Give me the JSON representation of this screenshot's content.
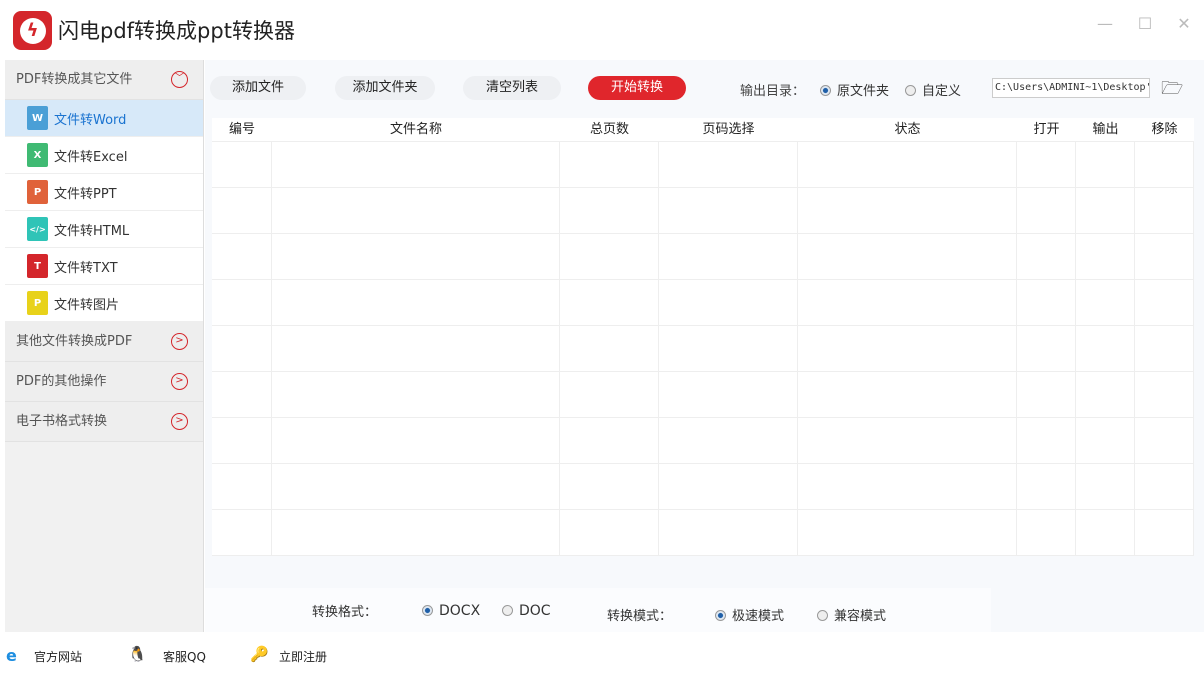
{
  "app": {
    "title": "闪电pdf转换成ppt转换器"
  },
  "sidebar": {
    "groups": [
      {
        "label": "PDF转换成其它文件"
      },
      {
        "label": "其他文件转换成PDF"
      },
      {
        "label": "PDF的其他操作"
      },
      {
        "label": "电子书格式转换"
      }
    ],
    "items": [
      {
        "label": "文件转Word",
        "icon": "W",
        "color": "#4a9fd6"
      },
      {
        "label": "文件转Excel",
        "icon": "X",
        "color": "#3fba73"
      },
      {
        "label": "文件转PPT",
        "icon": "P",
        "color": "#e0623a"
      },
      {
        "label": "文件转HTML",
        "icon": "</>",
        "color": "#2fc4b7"
      },
      {
        "label": "文件转TXT",
        "icon": "T",
        "color": "#d4262b"
      },
      {
        "label": "文件转图片",
        "icon": "P",
        "color": "#e8d21a"
      }
    ]
  },
  "toolbar": {
    "add_file": "添加文件",
    "add_folder": "添加文件夹",
    "clear": "清空列表",
    "start": "开始转换",
    "output_label": "输出目录：",
    "opt_original": "原文件夹",
    "opt_custom": "自定义",
    "path": "C:\\Users\\ADMINI~1\\Desktop'"
  },
  "table": {
    "headers": [
      "编号",
      "文件名称",
      "总页数",
      "页码选择",
      "状态",
      "打开",
      "输出",
      "移除"
    ]
  },
  "options": {
    "format_label": "转换格式：",
    "docx": "DOCX",
    "doc": "DOC",
    "mode_label": "转换模式：",
    "fast": "极速模式",
    "compat": "兼容模式"
  },
  "footer": {
    "site": "官方网站",
    "qq": "客服QQ",
    "register": "立即注册"
  },
  "colors": {
    "accent": "#e0262c",
    "selected": "#d7e9f9"
  }
}
